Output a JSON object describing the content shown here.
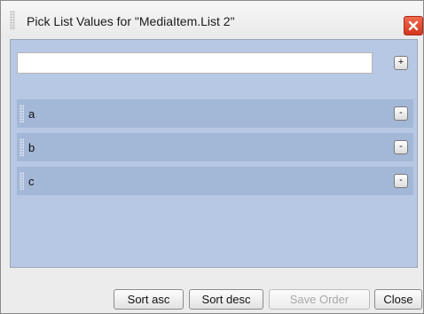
{
  "dialog": {
    "title": "Pick List Values for \"MediaItem.List 2\"",
    "close_icon": "close-x-icon",
    "colors": {
      "close": "#e0462c",
      "panel": "#b7c8e4",
      "row": "#a3b7d7"
    }
  },
  "new_value": {
    "value": "",
    "placeholder": "",
    "add_label": "+"
  },
  "items": [
    {
      "label": "a",
      "remove_label": "-"
    },
    {
      "label": "b",
      "remove_label": "-"
    },
    {
      "label": "c",
      "remove_label": "-"
    }
  ],
  "footer": {
    "sort_asc": "Sort asc",
    "sort_desc": "Sort desc",
    "save_order": "Save Order",
    "close": "Close"
  }
}
